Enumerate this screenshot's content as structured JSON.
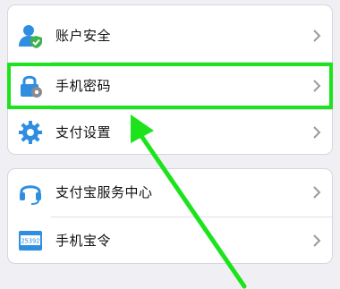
{
  "settings": {
    "group1": [
      {
        "label": "账户安全",
        "icon": "user-shield-icon"
      },
      {
        "label": "手机密码",
        "icon": "lock-gear-icon"
      },
      {
        "label": "支付设置",
        "icon": "gear-icon"
      }
    ],
    "group2": [
      {
        "label": "支付宝服务中心",
        "icon": "headset-icon"
      },
      {
        "label": "手机宝令",
        "icon": "token-display-icon",
        "token_code": "25392"
      }
    ]
  },
  "colors": {
    "accent_blue": "#2f8ee0",
    "highlight_green": "#1de31d",
    "background": "#efeff4"
  }
}
